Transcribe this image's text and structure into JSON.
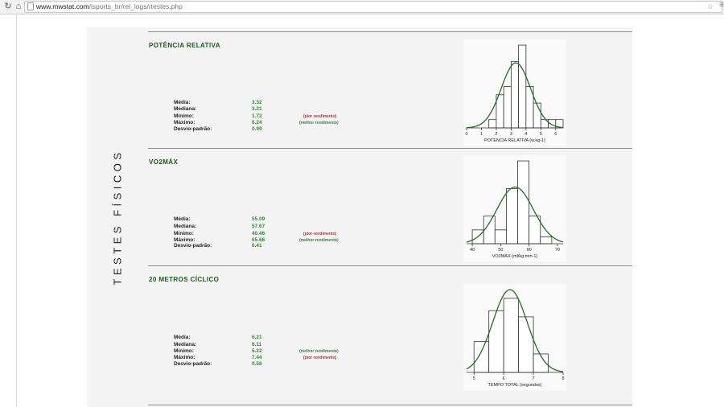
{
  "browser": {
    "url_host": "www.mwstat.com",
    "url_path": "/isports_br/rel_logs/rtestes.php",
    "back_icon": "reload-icon",
    "home_icon": "home-icon"
  },
  "page": {
    "vertical_title": "TESTES FÍSICOS",
    "labels": [
      "Média:",
      "Mediana:",
      "Mínimo:",
      "Máximo:",
      "Desvio-padrão:"
    ],
    "colors": {
      "title": "#1b5a1b",
      "value": "#2e8b2e",
      "worst": "#e02020",
      "best": "#2e8b2e",
      "curve": "#1f6e1f"
    }
  },
  "sections": [
    {
      "title": "POTÊNCIA RELATIVA",
      "stats": {
        "media": "3.32",
        "mediana": "3.21",
        "minimo": "1.72",
        "maximo": "6.24",
        "desvio": "0.99"
      },
      "notes": {
        "minimo": "(pior rendimento)",
        "maximo": "(melhor rendimento)"
      }
    },
    {
      "title": "VO2MÁX",
      "stats": {
        "media": "55.09",
        "mediana": "57.67",
        "minimo": "40.46",
        "maximo": "65.66",
        "desvio": "6.41"
      },
      "notes": {
        "minimo": "(pior rendimento)",
        "maximo": "(melhor rendimento)"
      }
    },
    {
      "title": "20 METROS CÍCLICO",
      "stats": {
        "media": "6.21",
        "mediana": "6.11",
        "minimo": "5.22",
        "maximo": "7.44",
        "desvio": "0.58"
      },
      "notes": {
        "minimo": "(melhor rendimento)",
        "maximo": "(pior rendimento)"
      }
    }
  ],
  "chart_data": [
    {
      "type": "bar",
      "xlabel": "POTENCIA RELATIVA (w.kg-1)",
      "xticks": [
        0,
        1,
        2,
        3,
        4,
        5,
        6
      ],
      "xlim": [
        0,
        6.5
      ],
      "bin_edges": [
        1.5,
        2.0,
        2.5,
        3.0,
        3.5,
        4.0,
        4.5,
        5.0,
        5.5,
        6.0,
        6.5
      ],
      "values": [
        1,
        4,
        5,
        8,
        10,
        5,
        3,
        1,
        1,
        1
      ],
      "normal_curve": {
        "mean": 3.32,
        "sd": 0.99
      }
    },
    {
      "type": "bar",
      "xlabel": "VO2MAX (ml/kg.min-1)",
      "xticks": [
        40,
        50,
        60,
        70
      ],
      "xlim": [
        38,
        72
      ],
      "bin_edges": [
        40,
        44,
        48,
        52,
        56,
        60,
        64,
        68
      ],
      "values": [
        2,
        4,
        2,
        8,
        12,
        4,
        1
      ],
      "normal_curve": {
        "mean": 55.09,
        "sd": 6.41
      }
    },
    {
      "type": "bar",
      "xlabel": "TEMPO TOTAL (segundos)",
      "xticks": [
        5,
        6,
        7,
        8
      ],
      "xlim": [
        4.75,
        8.0
      ],
      "bin_edges": [
        5.0,
        5.5,
        6.0,
        6.5,
        7.0,
        7.5
      ],
      "values": [
        5,
        10,
        12,
        9,
        3
      ],
      "normal_curve": {
        "mean": 6.21,
        "sd": 0.58
      }
    }
  ]
}
